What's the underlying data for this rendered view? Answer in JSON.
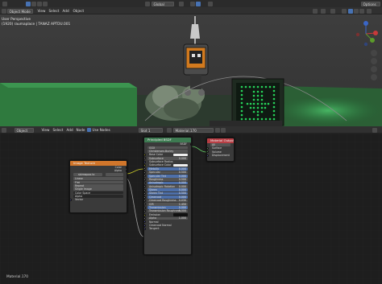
{
  "topbar": {
    "global_label": "Global",
    "options_label": "Options"
  },
  "viewport_header": {
    "mode_label": "Object Mode",
    "menu": [
      "View",
      "Select",
      "Add",
      "Object"
    ]
  },
  "viewport_info": {
    "line1": "User Perspective",
    "line2": "(1920) raumaplace | TANAZ APTDU.001"
  },
  "node_header": {
    "editor_type": "Object",
    "menu": [
      "View",
      "Select",
      "Add",
      "Node"
    ],
    "use_nodes_label": "Use Nodes",
    "slot_label": "Slot 1",
    "material_label": "Material.170"
  },
  "nodes": {
    "image_texture": {
      "title": "Image Texture",
      "outputs": [
        "Color",
        "Alpha"
      ],
      "image_name": "sbimwpaa.tx",
      "dropdowns": [
        "Linear",
        "Flat",
        "Repeat",
        "Single Image"
      ],
      "color_space_label": "Color Space",
      "alpha_label": "Alpha",
      "vector_label": "Vector"
    },
    "principled": {
      "title": "Principled BSDF",
      "output": "BSDF",
      "dropdowns": [
        "GGX",
        "Christensen-Burley"
      ],
      "rows": [
        {
          "label": "Base Color",
          "value": ""
        },
        {
          "label": "Subsurface",
          "value": "0.000"
        },
        {
          "label": "Subsurface Radius",
          "value": ""
        },
        {
          "label": "Subsurface Color",
          "value": ""
        },
        {
          "label": "Metallic",
          "value": "0.000"
        },
        {
          "label": "Specular",
          "value": "0.500"
        },
        {
          "label": "Specular Tint",
          "value": "0.000"
        },
        {
          "label": "Roughness",
          "value": "0.500"
        },
        {
          "label": "Anisotropic",
          "value": "0.000"
        },
        {
          "label": "Anisotropic Rotation",
          "value": "0.000"
        },
        {
          "label": "Sheen",
          "value": "0.000"
        },
        {
          "label": "Sheen Tint",
          "value": "0.500"
        },
        {
          "label": "Clearcoat",
          "value": "0.000"
        },
        {
          "label": "Clearcoat Roughness",
          "value": "0.030"
        },
        {
          "label": "IOR",
          "value": "1.450"
        },
        {
          "label": "Transmission",
          "value": "0.000"
        },
        {
          "label": "Transmission Roughness",
          "value": "0.000"
        },
        {
          "label": "Emission",
          "value": ""
        },
        {
          "label": "Alpha",
          "value": "1.000"
        },
        {
          "label": "Normal",
          "value": ""
        },
        {
          "label": "Clearcoat Normal",
          "value": ""
        },
        {
          "label": "Tangent",
          "value": ""
        }
      ]
    },
    "material_output": {
      "title": "Material Output",
      "target": "All",
      "inputs": [
        "Surface",
        "Volume",
        "Displacement"
      ]
    }
  },
  "footer": {
    "material_name": "Material.170"
  },
  "colors": {
    "image_header": "#d1762b",
    "principled_header": "#3d7a51",
    "output_header": "#b73e44",
    "selected_blue": "#4772b3",
    "led_green": "#27d35a"
  }
}
